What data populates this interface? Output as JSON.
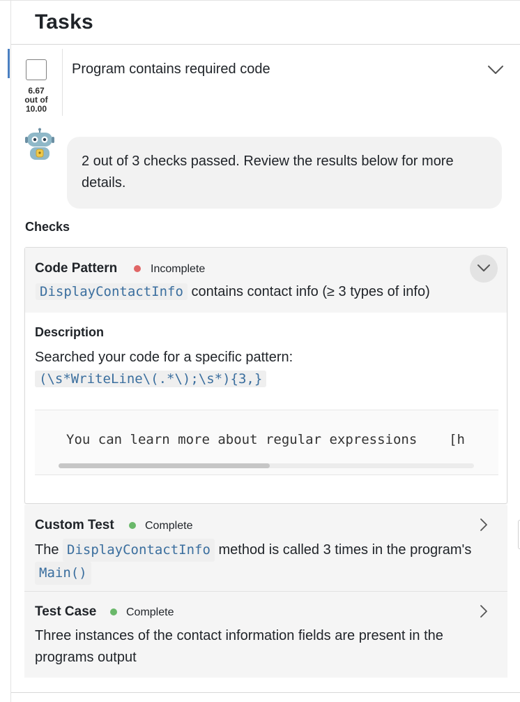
{
  "header": {
    "title": "Tasks"
  },
  "task": {
    "title": "Program contains required code",
    "score_value": "6.67",
    "score_out_of": "out of",
    "score_total": "10.00"
  },
  "assistant": {
    "message": "2 out of 3 checks passed. Review the results below for more details."
  },
  "checks": {
    "label": "Checks",
    "items": [
      {
        "type": "Code Pattern",
        "status": "Incomplete",
        "status_color": "#e06666",
        "code": "DisplayContactInfo",
        "summary": "contains contact info (≥ 3 types of info)",
        "description_label": "Description",
        "description_text": "Searched your code for a specific pattern:",
        "regex": "(\\s*WriteLine\\(.*\\);\\s*){3,}",
        "code_block": "You can learn more about regular expressions    [h"
      },
      {
        "type": "Custom Test",
        "status": "Complete",
        "status_color": "#6ab86a",
        "text_1": "The",
        "code_1": "DisplayContactInfo",
        "text_2": "method is called 3 times in the program's",
        "code_2": "Main()"
      },
      {
        "type": "Test Case",
        "status": "Complete",
        "status_color": "#6ab86a",
        "description": "Three instances of the contact information fields are present in the programs output"
      }
    ]
  },
  "icons": {
    "checkbox": "checkbox-icon",
    "expand": "chevron-down-icon",
    "collapse": "chevron-down-icon",
    "row_open": "chevron-right-icon",
    "assistant": "robot-icon"
  },
  "colors": {
    "accent": "#4a7fc1",
    "code_text": "#3a6e9e",
    "incomplete": "#e06666",
    "complete": "#6ab86a"
  }
}
